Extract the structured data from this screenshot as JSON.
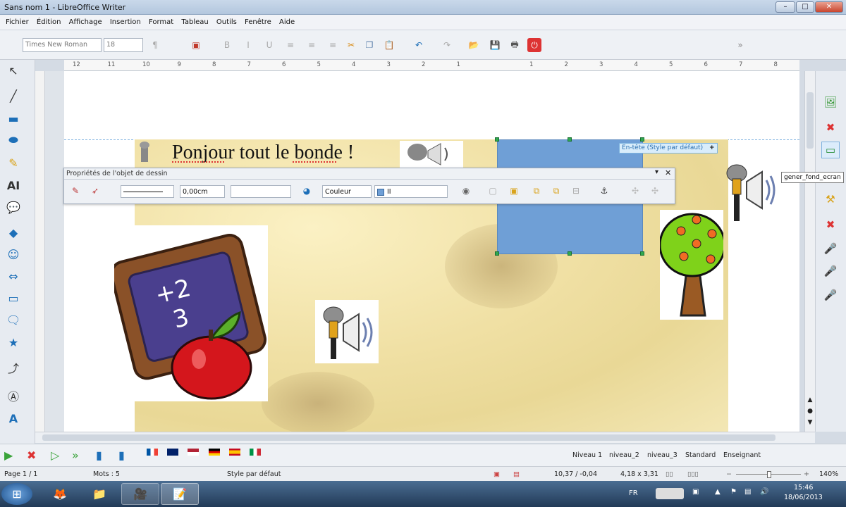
{
  "window": {
    "title": "Sans nom 1 - LibreOffice Writer",
    "controls": [
      "–",
      "□",
      "✕"
    ]
  },
  "menu": [
    "Fichier",
    "Édition",
    "Affichage",
    "Insertion",
    "Format",
    "Tableau",
    "Outils",
    "Fenêtre",
    "Aide"
  ],
  "toolbar": {
    "font_name": "Times New Roman",
    "font_size": "18"
  },
  "ruler": {
    "left_ticks": [
      "12",
      "11",
      "10",
      "9",
      "8",
      "7",
      "6",
      "5",
      "4",
      "3",
      "2",
      "1"
    ],
    "right_ticks": [
      "1",
      "2",
      "3",
      "4",
      "5",
      "6",
      "7",
      "8"
    ]
  },
  "document": {
    "header_text": "Ponjour tout le bonde !",
    "header_tag": "En-tête (Style par défaut)",
    "header_tag_plus": "+",
    "chalkboard": {
      "line1": "+2",
      "line2": "3"
    }
  },
  "drawing_props": {
    "title": "Propriétés de l'objet de dessin",
    "line_width": "0,00cm",
    "fill_type": "Couleur",
    "fill_value": "II"
  },
  "tooltip": "gener_fond_ecran",
  "bottom_levels": [
    "Niveau 1",
    "niveau_2",
    "niveau_3",
    "Standard",
    "Enseignant"
  ],
  "status": {
    "page": "Page 1 / 1",
    "words": "Mots : 5",
    "style": "Style par défaut",
    "position": "10,37 / -0,04",
    "size": "4,18 x 3,31",
    "zoom": "140%"
  },
  "taskbar": {
    "lang": "FR",
    "time": "15:46",
    "date": "18/06/2013"
  },
  "colors": {
    "accent": "#1d6fb8",
    "blue_shape": "#6f9fd6",
    "taskbar": "#2f4f73"
  }
}
